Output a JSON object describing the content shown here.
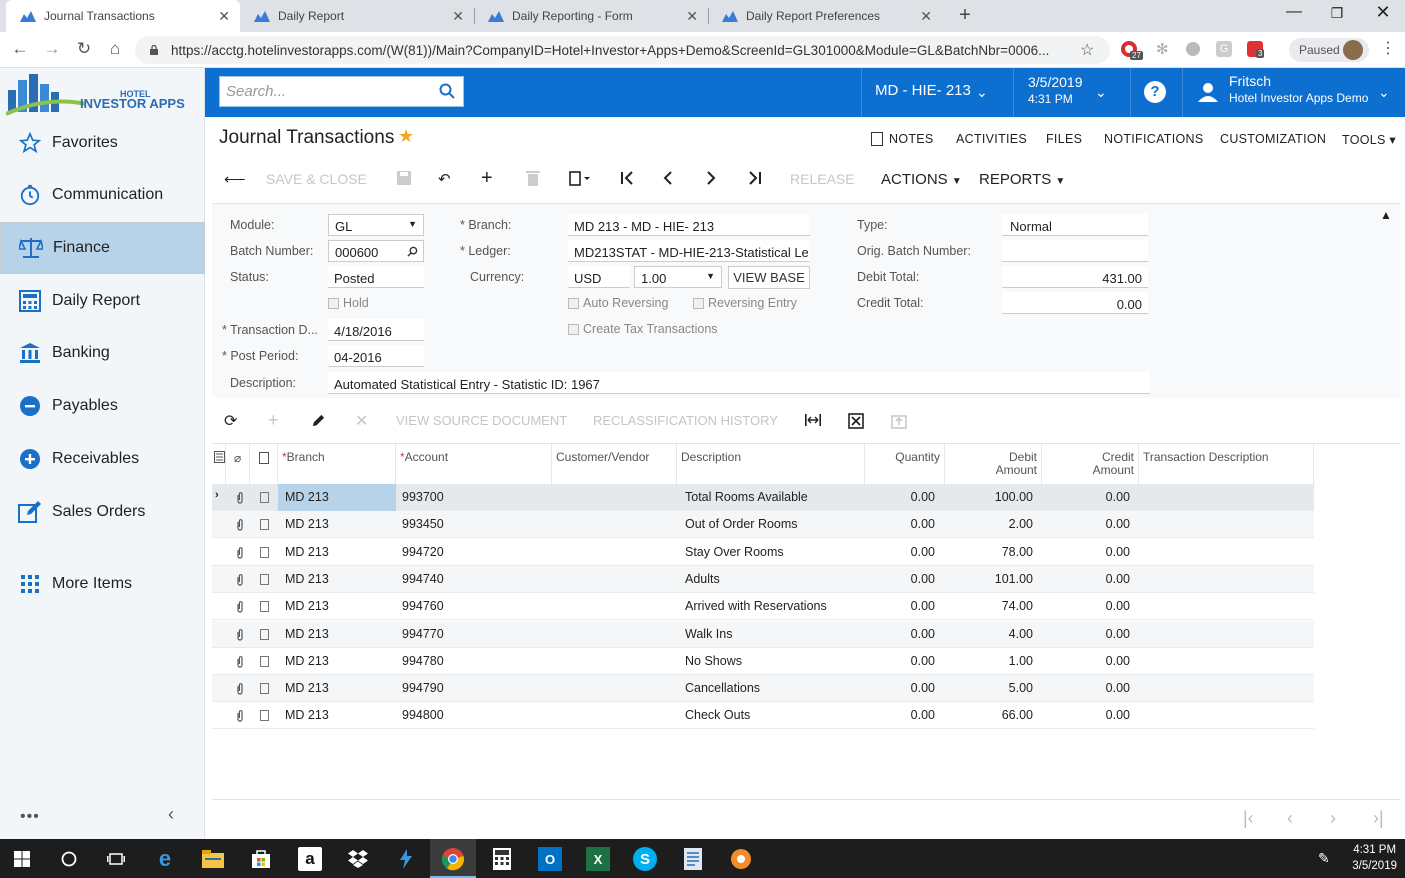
{
  "browser": {
    "tabs": [
      {
        "title": "Journal Transactions",
        "active": true
      },
      {
        "title": "Daily Report",
        "active": false
      },
      {
        "title": "Daily Reporting - Form",
        "active": false
      },
      {
        "title": "Daily Report Preferences",
        "active": false
      }
    ],
    "url": "https://acctg.hotelinvestorapps.com/(W(81))/Main?CompanyID=Hotel+Investor+Apps+Demo&ScreenId=GL301000&Module=GL&BatchNbr=0006...",
    "paused_label": "Paused",
    "ext_badges": {
      "first": "27",
      "last": "3"
    }
  },
  "logo": {
    "line1": "HOTEL",
    "line2": "INVESTOR APPS"
  },
  "sidebar": {
    "items": [
      {
        "label": "Favorites",
        "icon": "star-icon"
      },
      {
        "label": "Communication",
        "icon": "clock-icon"
      },
      {
        "label": "Finance",
        "icon": "scales-icon",
        "selected": true
      },
      {
        "label": "Daily Report",
        "icon": "calculator-icon"
      },
      {
        "label": "Banking",
        "icon": "bank-icon"
      },
      {
        "label": "Payables",
        "icon": "minus-circle-icon"
      },
      {
        "label": "Receivables",
        "icon": "plus-circle-icon"
      },
      {
        "label": "Sales Orders",
        "icon": "edit-icon"
      },
      {
        "label": "More Items",
        "icon": "grid-icon"
      }
    ],
    "dots": "•••",
    "collapse": "‹"
  },
  "topbar": {
    "search_placeholder": "Search...",
    "branch": "MD - HIE- 213",
    "date": "3/5/2019",
    "time": "4:31 PM",
    "help": "?",
    "user_name": "Fritsch",
    "company": "Hotel Investor Apps Demo"
  },
  "page": {
    "title": "Journal Transactions",
    "links": [
      "NOTES",
      "ACTIVITIES",
      "FILES",
      "NOTIFICATIONS",
      "CUSTOMIZATION",
      "TOOLS"
    ]
  },
  "toolbar": {
    "save_close": "SAVE & CLOSE",
    "release": "RELEASE",
    "actions": "ACTIONS",
    "reports": "REPORTS"
  },
  "form": {
    "module_label": "Module:",
    "module_value": "GL",
    "batch_label": "Batch Number:",
    "batch_value": "000600",
    "status_label": "Status:",
    "status_value": "Posted",
    "hold_label": "Hold",
    "trandate_label": "Transaction D...",
    "trandate_value": "4/18/2016",
    "postperiod_label": "Post Period:",
    "postperiod_value": "04-2016",
    "description_label": "Description:",
    "description_value": "Automated Statistical Entry - Statistic ID: 1967",
    "branch_label": "Branch:",
    "branch_value": "MD 213 - MD - HIE- 213",
    "ledger_label": "Ledger:",
    "ledger_value": "MD213STAT - MD-HIE-213-Statistical Le",
    "currency_label": "Currency:",
    "currency_value": "USD",
    "rate_value": "1.00",
    "view_base": "VIEW BASE",
    "auto_rev_label": "Auto Reversing",
    "rev_entry_label": "Reversing Entry",
    "create_tax_label": "Create Tax Transactions",
    "type_label": "Type:",
    "type_value": "Normal",
    "orig_batch_label": "Orig. Batch Number:",
    "debit_total_label": "Debit Total:",
    "debit_total_value": "431.00",
    "credit_total_label": "Credit Total:",
    "credit_total_value": "0.00"
  },
  "grid_toolbar": {
    "view_source": "VIEW SOURCE DOCUMENT",
    "reclass_history": "RECLASSIFICATION HISTORY"
  },
  "grid": {
    "headers": {
      "branch": "Branch",
      "account": "Account",
      "customer": "Customer/Vendor",
      "description": "Description",
      "quantity": "Quantity",
      "debit1": "Debit",
      "debit2": "Amount",
      "credit1": "Credit",
      "credit2": "Amount",
      "tran_desc": "Transaction Description"
    },
    "rows": [
      {
        "branch": "MD 213",
        "account": "993700",
        "description": "Total Rooms Available",
        "quantity": "0.00",
        "debit": "100.00",
        "credit": "0.00"
      },
      {
        "branch": "MD 213",
        "account": "993450",
        "description": "Out of Order Rooms",
        "quantity": "0.00",
        "debit": "2.00",
        "credit": "0.00"
      },
      {
        "branch": "MD 213",
        "account": "994720",
        "description": "Stay Over Rooms",
        "quantity": "0.00",
        "debit": "78.00",
        "credit": "0.00"
      },
      {
        "branch": "MD 213",
        "account": "994740",
        "description": "Adults",
        "quantity": "0.00",
        "debit": "101.00",
        "credit": "0.00"
      },
      {
        "branch": "MD 213",
        "account": "994760",
        "description": "Arrived with Reservations",
        "quantity": "0.00",
        "debit": "74.00",
        "credit": "0.00"
      },
      {
        "branch": "MD 213",
        "account": "994770",
        "description": "Walk Ins",
        "quantity": "0.00",
        "debit": "4.00",
        "credit": "0.00"
      },
      {
        "branch": "MD 213",
        "account": "994780",
        "description": "No Shows",
        "quantity": "0.00",
        "debit": "1.00",
        "credit": "0.00"
      },
      {
        "branch": "MD 213",
        "account": "994790",
        "description": "Cancellations",
        "quantity": "0.00",
        "debit": "5.00",
        "credit": "0.00"
      },
      {
        "branch": "MD 213",
        "account": "994800",
        "description": "Check Outs",
        "quantity": "0.00",
        "debit": "66.00",
        "credit": "0.00"
      }
    ]
  },
  "taskbar": {
    "time": "4:31 PM",
    "date": "3/5/2019"
  },
  "colors": {
    "accent": "#0d6fd0",
    "sidebar_selected": "#b7d3ea",
    "star": "#f5a623"
  }
}
